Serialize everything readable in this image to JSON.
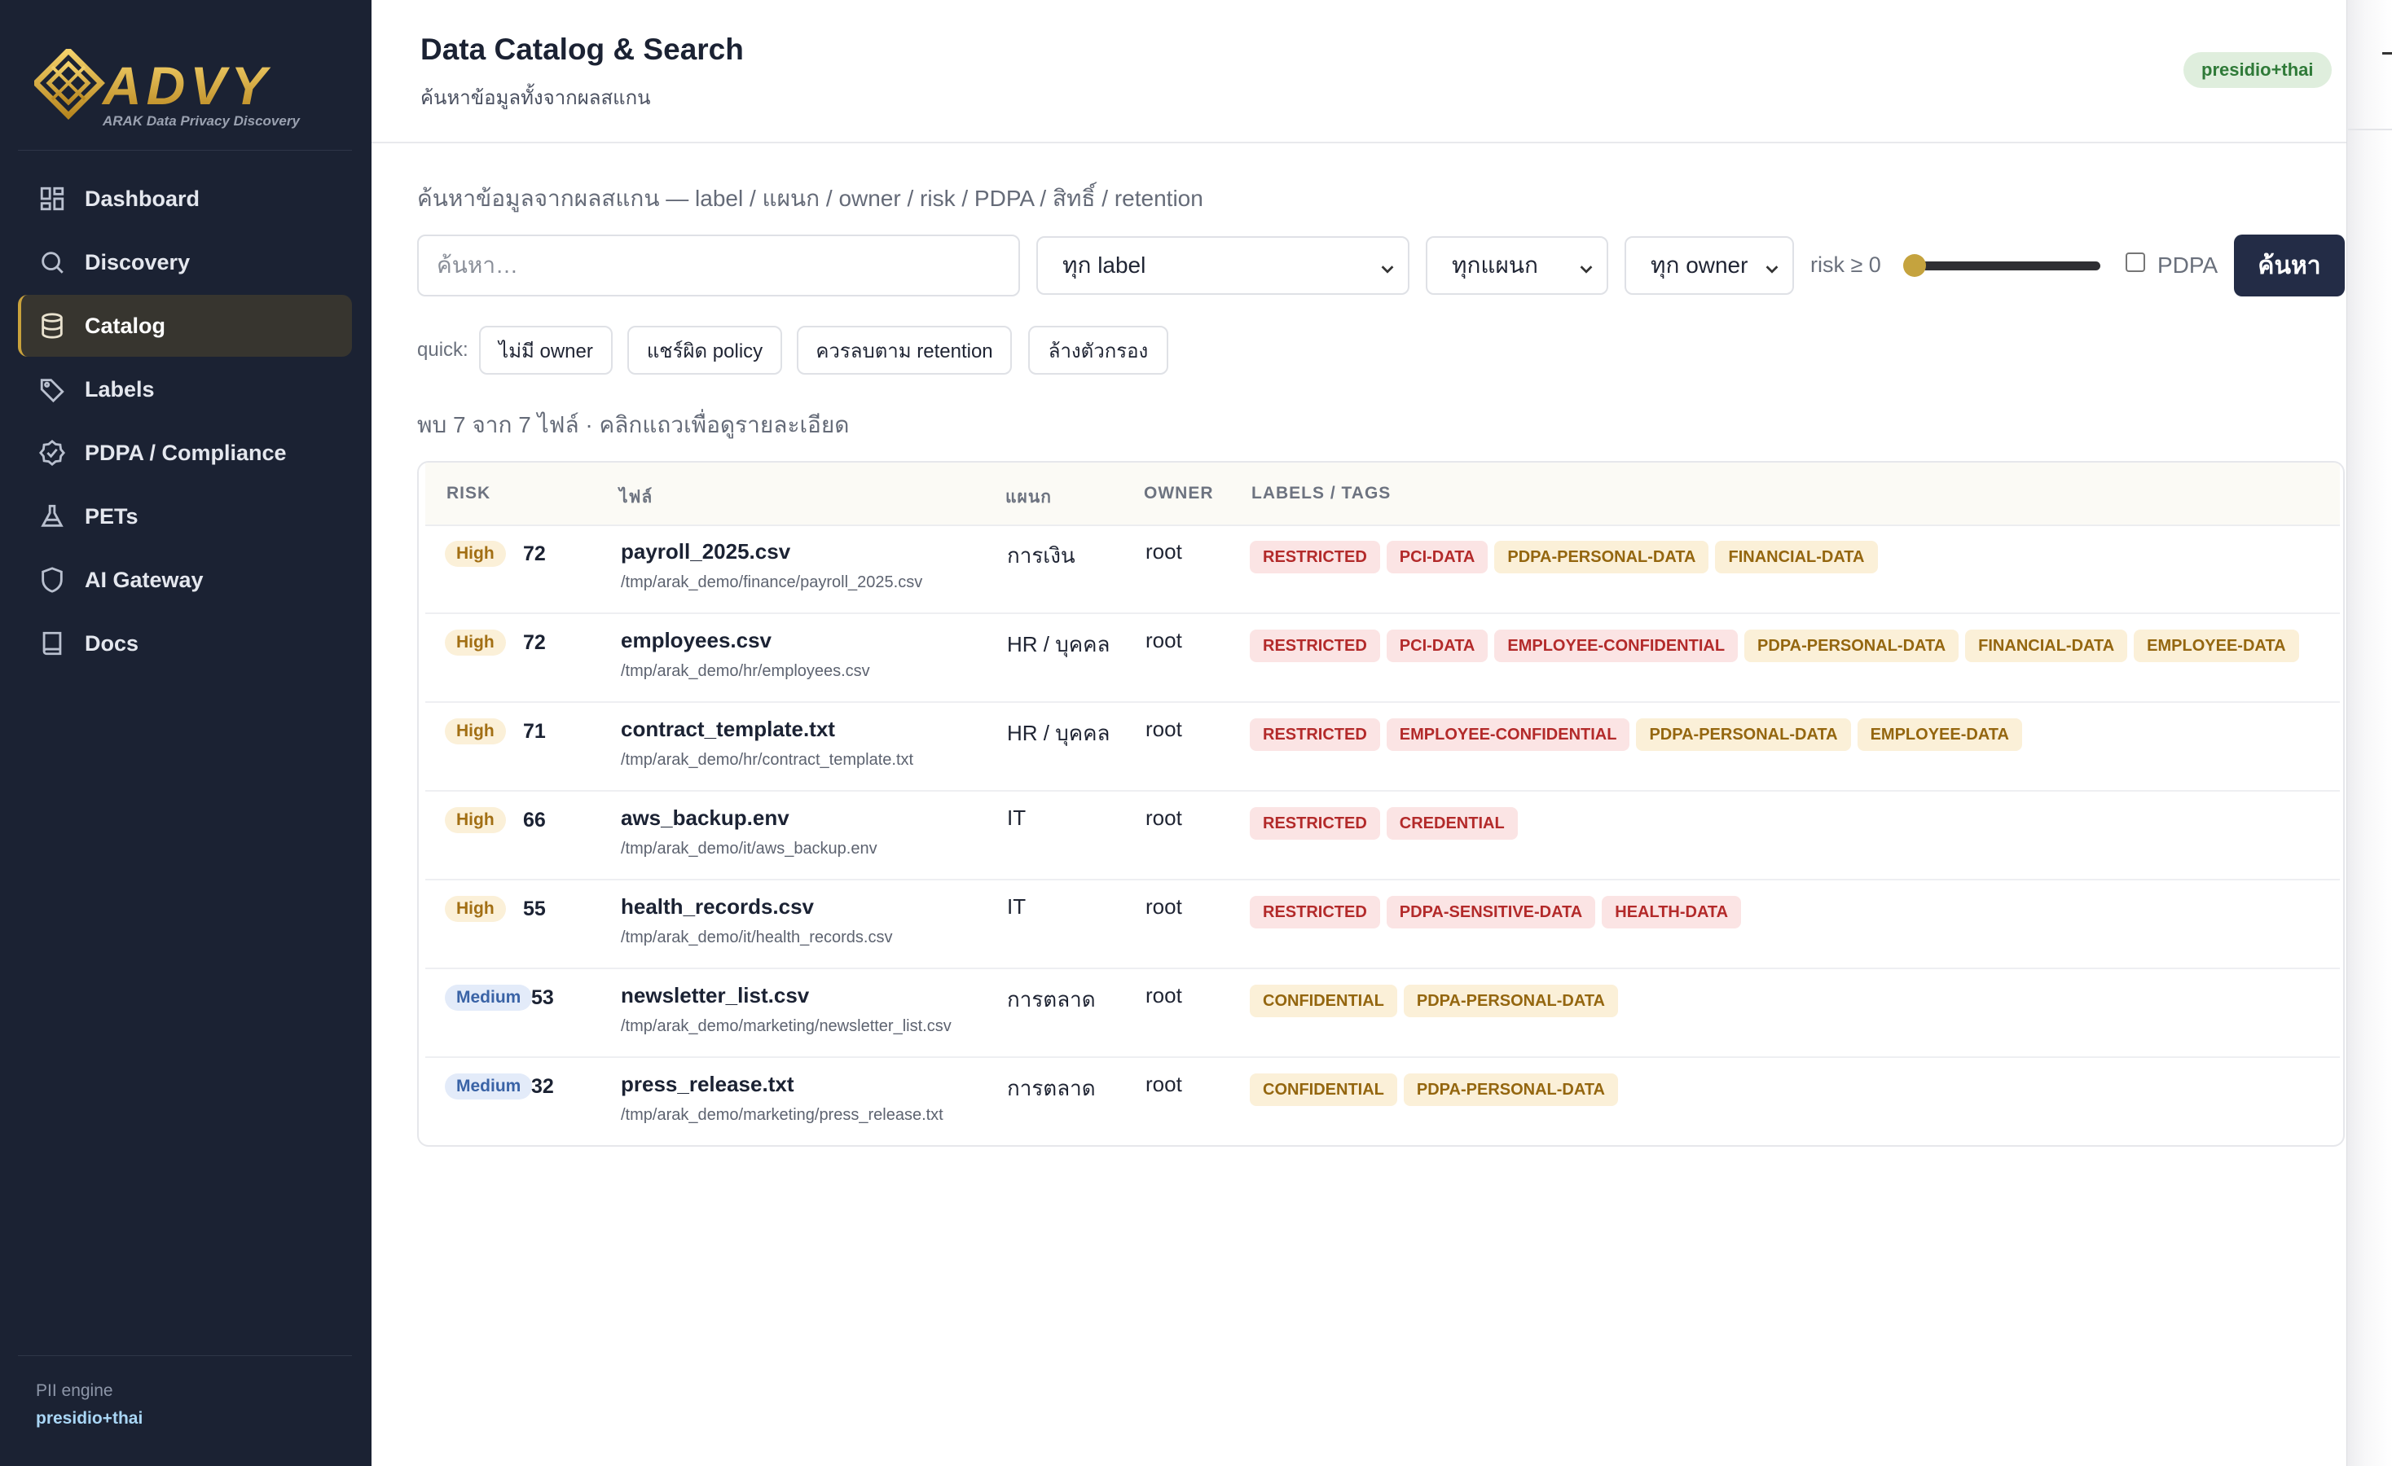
{
  "app": {
    "logo_text": "ADVY",
    "logo_sub": "ARAK Data Privacy Discovery"
  },
  "sidebar": {
    "items": [
      {
        "label": "Dashboard",
        "icon": "grid-icon",
        "active": false
      },
      {
        "label": "Discovery",
        "icon": "search-icon",
        "active": false
      },
      {
        "label": "Catalog",
        "icon": "database-icon",
        "active": true
      },
      {
        "label": "Labels",
        "icon": "tag-icon",
        "active": false
      },
      {
        "label": "PDPA / Compliance",
        "icon": "check-shield-icon",
        "active": false
      },
      {
        "label": "PETs",
        "icon": "flask-icon",
        "active": false
      },
      {
        "label": "AI Gateway",
        "icon": "shield-icon",
        "active": false
      },
      {
        "label": "Docs",
        "icon": "book-icon",
        "active": false
      }
    ],
    "engine_label": "PII engine",
    "engine_value": "presidio+thai"
  },
  "header": {
    "title": "Data Catalog & Search",
    "subtitle": "ค้นหาข้อมูลทั้งจากผลสแกน",
    "engine_badge": "presidio+thai"
  },
  "search": {
    "label": "ค้นหาข้อมูลจากผลสแกน — label / แผนก / owner / risk / PDPA / สิทธิ์ / retention",
    "placeholder": "ค้นหา…",
    "label_filter": "ทุก label",
    "dept_filter": "ทุกแผนก",
    "owner_filter": "ทุก owner",
    "risk_label": "risk ≥ 0",
    "risk_min": 0,
    "pdpa_label": "PDPA",
    "pdpa_checked": false,
    "button": "ค้นหา"
  },
  "quick": {
    "label": "quick:",
    "chips": [
      "ไม่มี owner",
      "แชร์ผิด policy",
      "ควรลบตาม retention",
      "ล้างตัวกรอง"
    ]
  },
  "results": {
    "summary": "พบ 7 จาก 7 ไฟล์ · คลิกแถวเพื่อดูรายละเอียด"
  },
  "table": {
    "headers": [
      "RISK",
      "ไฟล์",
      "แผนก",
      "OWNER",
      "LABELS / TAGS"
    ],
    "rows": [
      {
        "risk": "High",
        "score": "72",
        "name": "payroll_2025.csv",
        "path": "/tmp/arak_demo/finance/payroll_2025.csv",
        "dept": "การเงิน",
        "owner": "root",
        "tags": [
          {
            "text": "RESTRICTED",
            "tone": "red"
          },
          {
            "text": "PCI-DATA",
            "tone": "red"
          },
          {
            "text": "PDPA-PERSONAL-DATA",
            "tone": "amber"
          },
          {
            "text": "FINANCIAL-DATA",
            "tone": "amber"
          }
        ]
      },
      {
        "risk": "High",
        "score": "72",
        "name": "employees.csv",
        "path": "/tmp/arak_demo/hr/employees.csv",
        "dept": "HR / บุคคล",
        "owner": "root",
        "tags": [
          {
            "text": "RESTRICTED",
            "tone": "red"
          },
          {
            "text": "PCI-DATA",
            "tone": "red"
          },
          {
            "text": "EMPLOYEE-CONFIDENTIAL",
            "tone": "red"
          },
          {
            "text": "PDPA-PERSONAL-DATA",
            "tone": "amber"
          },
          {
            "text": "FINANCIAL-DATA",
            "tone": "amber"
          },
          {
            "text": "EMPLOYEE-DATA",
            "tone": "amber"
          }
        ]
      },
      {
        "risk": "High",
        "score": "71",
        "name": "contract_template.txt",
        "path": "/tmp/arak_demo/hr/contract_template.txt",
        "dept": "HR / บุคคล",
        "owner": "root",
        "tags": [
          {
            "text": "RESTRICTED",
            "tone": "red"
          },
          {
            "text": "EMPLOYEE-CONFIDENTIAL",
            "tone": "red"
          },
          {
            "text": "PDPA-PERSONAL-DATA",
            "tone": "amber"
          },
          {
            "text": "EMPLOYEE-DATA",
            "tone": "amber"
          }
        ]
      },
      {
        "risk": "High",
        "score": "66",
        "name": "aws_backup.env",
        "path": "/tmp/arak_demo/it/aws_backup.env",
        "dept": "IT",
        "owner": "root",
        "tags": [
          {
            "text": "RESTRICTED",
            "tone": "red"
          },
          {
            "text": "CREDENTIAL",
            "tone": "red"
          }
        ]
      },
      {
        "risk": "High",
        "score": "55",
        "name": "health_records.csv",
        "path": "/tmp/arak_demo/it/health_records.csv",
        "dept": "IT",
        "owner": "root",
        "tags": [
          {
            "text": "RESTRICTED",
            "tone": "red"
          },
          {
            "text": "PDPA-SENSITIVE-DATA",
            "tone": "red"
          },
          {
            "text": "HEALTH-DATA",
            "tone": "red"
          }
        ]
      },
      {
        "risk": "Medium",
        "score": "53",
        "name": "newsletter_list.csv",
        "path": "/tmp/arak_demo/marketing/newsletter_list.csv",
        "dept": "การตลาด",
        "owner": "root",
        "tags": [
          {
            "text": "CONFIDENTIAL",
            "tone": "amber"
          },
          {
            "text": "PDPA-PERSONAL-DATA",
            "tone": "amber"
          }
        ]
      },
      {
        "risk": "Medium",
        "score": "32",
        "name": "press_release.txt",
        "path": "/tmp/arak_demo/marketing/press_release.txt",
        "dept": "การตลาด",
        "owner": "root",
        "tags": [
          {
            "text": "CONFIDENTIAL",
            "tone": "amber"
          },
          {
            "text": "PDPA-PERSONAL-DATA",
            "tone": "amber"
          }
        ]
      }
    ]
  },
  "colors": {
    "sidebar_bg": "#1b2233",
    "accent_gold": "#c9a23c",
    "primary_button": "#232c46",
    "high_badge": "#fbf0d8",
    "medium_badge": "#e3ebf9",
    "tag_red": "#b32a2a",
    "tag_amber": "#94660f"
  }
}
